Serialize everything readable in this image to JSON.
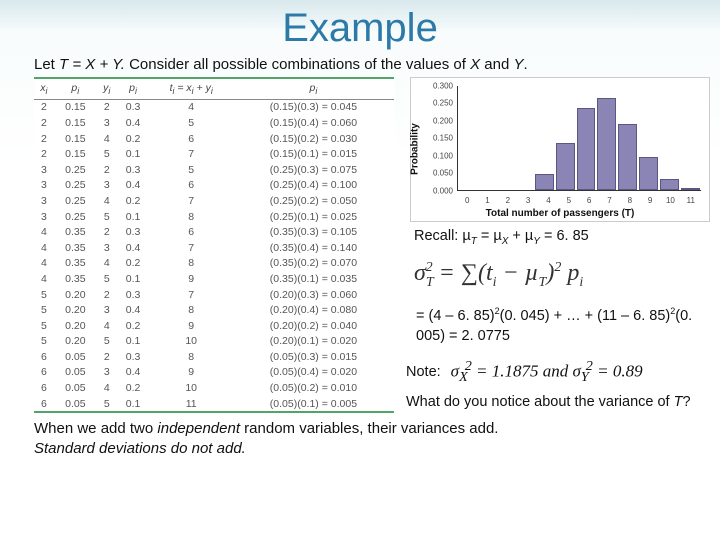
{
  "title": "Example",
  "intro_a": "Let ",
  "intro_b": "T = X + Y.",
  "intro_c": " Consider all possible combinations of the values of ",
  "intro_d": "X",
  "intro_e": " and ",
  "intro_f": "Y",
  "intro_g": ".",
  "table": {
    "headers": [
      "x",
      "p",
      "y",
      "p",
      "t = x + y",
      "p"
    ],
    "header_subs": [
      "i",
      "i",
      "i",
      "i",
      "i",
      "i",
      "i",
      "i"
    ],
    "rows": [
      [
        "2",
        "0.15",
        "2",
        "0.3",
        "4",
        "(0.15)(0.3) = 0.045"
      ],
      [
        "2",
        "0.15",
        "3",
        "0.4",
        "5",
        "(0.15)(0.4) = 0.060"
      ],
      [
        "2",
        "0.15",
        "4",
        "0.2",
        "6",
        "(0.15)(0.2) = 0.030"
      ],
      [
        "2",
        "0.15",
        "5",
        "0.1",
        "7",
        "(0.15)(0.1) = 0.015"
      ],
      [
        "3",
        "0.25",
        "2",
        "0.3",
        "5",
        "(0.25)(0.3) = 0.075"
      ],
      [
        "3",
        "0.25",
        "3",
        "0.4",
        "6",
        "(0.25)(0.4) = 0.100"
      ],
      [
        "3",
        "0.25",
        "4",
        "0.2",
        "7",
        "(0.25)(0.2) = 0.050"
      ],
      [
        "3",
        "0.25",
        "5",
        "0.1",
        "8",
        "(0.25)(0.1) = 0.025"
      ],
      [
        "4",
        "0.35",
        "2",
        "0.3",
        "6",
        "(0.35)(0.3) = 0.105"
      ],
      [
        "4",
        "0.35",
        "3",
        "0.4",
        "7",
        "(0.35)(0.4) = 0.140"
      ],
      [
        "4",
        "0.35",
        "4",
        "0.2",
        "8",
        "(0.35)(0.2) = 0.070"
      ],
      [
        "4",
        "0.35",
        "5",
        "0.1",
        "9",
        "(0.35)(0.1) = 0.035"
      ],
      [
        "5",
        "0.20",
        "2",
        "0.3",
        "7",
        "(0.20)(0.3) = 0.060"
      ],
      [
        "5",
        "0.20",
        "3",
        "0.4",
        "8",
        "(0.20)(0.4) = 0.080"
      ],
      [
        "5",
        "0.20",
        "4",
        "0.2",
        "9",
        "(0.20)(0.2) = 0.040"
      ],
      [
        "5",
        "0.20",
        "5",
        "0.1",
        "10",
        "(0.20)(0.1) = 0.020"
      ],
      [
        "6",
        "0.05",
        "2",
        "0.3",
        "8",
        "(0.05)(0.3) = 0.015"
      ],
      [
        "6",
        "0.05",
        "3",
        "0.4",
        "9",
        "(0.05)(0.4) = 0.020"
      ],
      [
        "6",
        "0.05",
        "4",
        "0.2",
        "10",
        "(0.05)(0.2) = 0.010"
      ],
      [
        "6",
        "0.05",
        "5",
        "0.1",
        "11",
        "(0.05)(0.1) = 0.005"
      ]
    ]
  },
  "chart_data": {
    "type": "bar",
    "categories": [
      "0",
      "1",
      "2",
      "3",
      "4",
      "5",
      "6",
      "7",
      "8",
      "9",
      "10",
      "11"
    ],
    "values": [
      0,
      0,
      0,
      0,
      0.045,
      0.135,
      0.235,
      0.265,
      0.19,
      0.095,
      0.03,
      0.005
    ],
    "ylabel": "Probability",
    "xlabel": "Total number of passengers (T)",
    "ylim": [
      0,
      0.3
    ],
    "yticks": [
      "0.000",
      "0.050",
      "0.100",
      "0.150",
      "0.200",
      "0.250",
      "0.300"
    ]
  },
  "recall_a": "Recall: µ",
  "recall_b": " = µ",
  "recall_c": " + µ",
  "recall_d": " = 6. 85",
  "sub_T": "T",
  "sub_X": "X",
  "sub_Y": "Y",
  "formula": "σ  = ∑(t  − µ  )  p",
  "formula_render": "σ<sub style='font-size:14px'>T</sub><sup style='font-size:14px;margin-left:-8px'>2</sup> = ∑(t<sub style='font-size:14px'>i</sub> − µ<sub style='font-size:14px'>T</sub>)<sup style='font-size:14px'>2</sup> p<sub style='font-size:14px'>i</sub>",
  "calc_a": "= (4 – 6. 85)",
  "calc_b": "(0. 045) + … + (11 – 6. 85)",
  "calc_c": "(0. 005) = 2. 0775",
  "sup2": "2",
  "note_label": "Note:",
  "note_formula": "σ<sub>X</sub><sup style='margin-left:-3px'>2</sup> = 1.1875 and σ<sub>Y</sub><sup style='margin-left:-3px'>2</sup> = 0.89",
  "question_a": "What do you notice about the variance of ",
  "question_b": "T",
  "question_c": "?",
  "bottom_a": "When we add two ",
  "bottom_b": "independent",
  "bottom_c": " random variables, their variances add. ",
  "bottom_d": "Standard deviations do not add."
}
